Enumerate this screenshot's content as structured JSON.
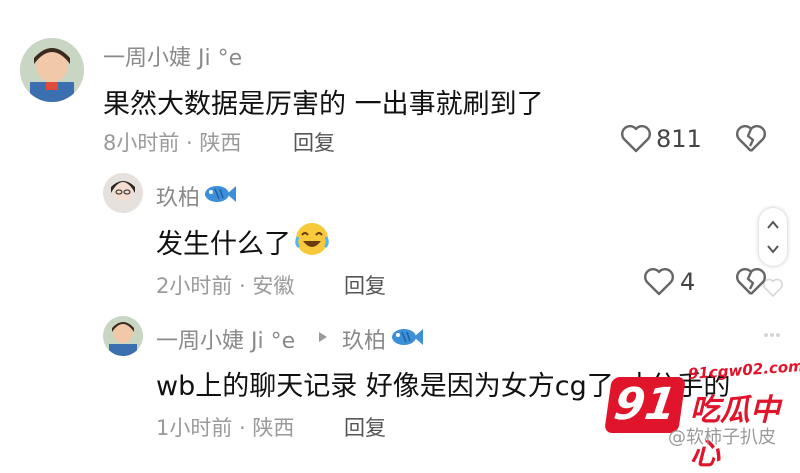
{
  "comments": [
    {
      "user": "一周小婕 Ji °e",
      "text": "果然大数据是厉害的 一出事就刷到了",
      "time_location": "8小时前 · 陕西",
      "reply_label": "回复",
      "like_count": "811"
    },
    {
      "user": "玖柏",
      "text": "发生什么了",
      "time_location": "2小时前 · 安徽",
      "reply_label": "回复",
      "like_count": "4"
    },
    {
      "user": "一周小婕 Ji °e",
      "reply_to": "玖柏",
      "text": "wb上的聊天记录 好像是因为女方cg了 才分手的",
      "time_location": "1小时前 · 陕西",
      "reply_label": "回复"
    }
  ],
  "watermark": {
    "number": "91",
    "site": "91cgw02.com",
    "brand": "吃瓜中心",
    "credit": "@软柿子扒皮"
  },
  "colors": {
    "accent_red": "#e0152b",
    "fish_blue": "#3d8fd8"
  }
}
